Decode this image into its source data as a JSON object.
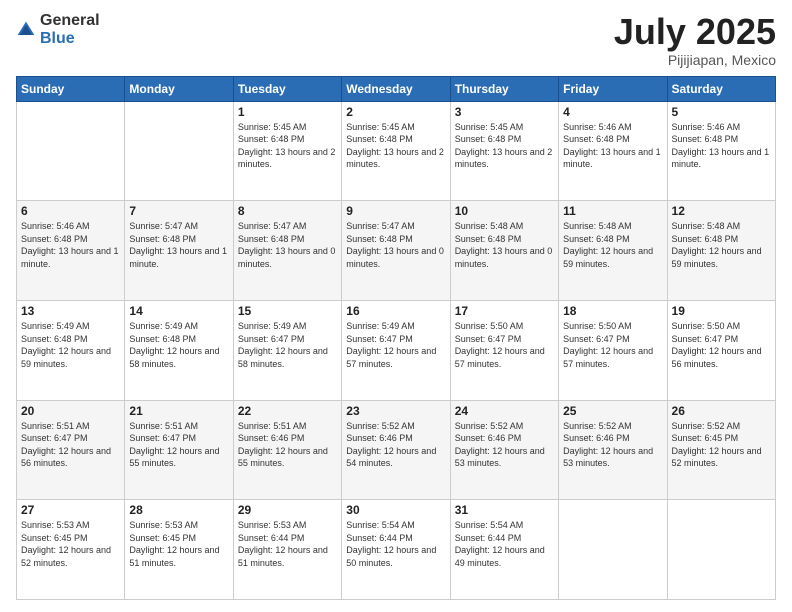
{
  "logo": {
    "general": "General",
    "blue": "Blue"
  },
  "header": {
    "month": "July 2025",
    "location": "Pijijiapan, Mexico"
  },
  "weekdays": [
    "Sunday",
    "Monday",
    "Tuesday",
    "Wednesday",
    "Thursday",
    "Friday",
    "Saturday"
  ],
  "weeks": [
    [
      {
        "day": "",
        "info": ""
      },
      {
        "day": "",
        "info": ""
      },
      {
        "day": "1",
        "info": "Sunrise: 5:45 AM\nSunset: 6:48 PM\nDaylight: 13 hours and 2 minutes."
      },
      {
        "day": "2",
        "info": "Sunrise: 5:45 AM\nSunset: 6:48 PM\nDaylight: 13 hours and 2 minutes."
      },
      {
        "day": "3",
        "info": "Sunrise: 5:45 AM\nSunset: 6:48 PM\nDaylight: 13 hours and 2 minutes."
      },
      {
        "day": "4",
        "info": "Sunrise: 5:46 AM\nSunset: 6:48 PM\nDaylight: 13 hours and 1 minute."
      },
      {
        "day": "5",
        "info": "Sunrise: 5:46 AM\nSunset: 6:48 PM\nDaylight: 13 hours and 1 minute."
      }
    ],
    [
      {
        "day": "6",
        "info": "Sunrise: 5:46 AM\nSunset: 6:48 PM\nDaylight: 13 hours and 1 minute."
      },
      {
        "day": "7",
        "info": "Sunrise: 5:47 AM\nSunset: 6:48 PM\nDaylight: 13 hours and 1 minute."
      },
      {
        "day": "8",
        "info": "Sunrise: 5:47 AM\nSunset: 6:48 PM\nDaylight: 13 hours and 0 minutes."
      },
      {
        "day": "9",
        "info": "Sunrise: 5:47 AM\nSunset: 6:48 PM\nDaylight: 13 hours and 0 minutes."
      },
      {
        "day": "10",
        "info": "Sunrise: 5:48 AM\nSunset: 6:48 PM\nDaylight: 13 hours and 0 minutes."
      },
      {
        "day": "11",
        "info": "Sunrise: 5:48 AM\nSunset: 6:48 PM\nDaylight: 12 hours and 59 minutes."
      },
      {
        "day": "12",
        "info": "Sunrise: 5:48 AM\nSunset: 6:48 PM\nDaylight: 12 hours and 59 minutes."
      }
    ],
    [
      {
        "day": "13",
        "info": "Sunrise: 5:49 AM\nSunset: 6:48 PM\nDaylight: 12 hours and 59 minutes."
      },
      {
        "day": "14",
        "info": "Sunrise: 5:49 AM\nSunset: 6:48 PM\nDaylight: 12 hours and 58 minutes."
      },
      {
        "day": "15",
        "info": "Sunrise: 5:49 AM\nSunset: 6:47 PM\nDaylight: 12 hours and 58 minutes."
      },
      {
        "day": "16",
        "info": "Sunrise: 5:49 AM\nSunset: 6:47 PM\nDaylight: 12 hours and 57 minutes."
      },
      {
        "day": "17",
        "info": "Sunrise: 5:50 AM\nSunset: 6:47 PM\nDaylight: 12 hours and 57 minutes."
      },
      {
        "day": "18",
        "info": "Sunrise: 5:50 AM\nSunset: 6:47 PM\nDaylight: 12 hours and 57 minutes."
      },
      {
        "day": "19",
        "info": "Sunrise: 5:50 AM\nSunset: 6:47 PM\nDaylight: 12 hours and 56 minutes."
      }
    ],
    [
      {
        "day": "20",
        "info": "Sunrise: 5:51 AM\nSunset: 6:47 PM\nDaylight: 12 hours and 56 minutes."
      },
      {
        "day": "21",
        "info": "Sunrise: 5:51 AM\nSunset: 6:47 PM\nDaylight: 12 hours and 55 minutes."
      },
      {
        "day": "22",
        "info": "Sunrise: 5:51 AM\nSunset: 6:46 PM\nDaylight: 12 hours and 55 minutes."
      },
      {
        "day": "23",
        "info": "Sunrise: 5:52 AM\nSunset: 6:46 PM\nDaylight: 12 hours and 54 minutes."
      },
      {
        "day": "24",
        "info": "Sunrise: 5:52 AM\nSunset: 6:46 PM\nDaylight: 12 hours and 53 minutes."
      },
      {
        "day": "25",
        "info": "Sunrise: 5:52 AM\nSunset: 6:46 PM\nDaylight: 12 hours and 53 minutes."
      },
      {
        "day": "26",
        "info": "Sunrise: 5:52 AM\nSunset: 6:45 PM\nDaylight: 12 hours and 52 minutes."
      }
    ],
    [
      {
        "day": "27",
        "info": "Sunrise: 5:53 AM\nSunset: 6:45 PM\nDaylight: 12 hours and 52 minutes."
      },
      {
        "day": "28",
        "info": "Sunrise: 5:53 AM\nSunset: 6:45 PM\nDaylight: 12 hours and 51 minutes."
      },
      {
        "day": "29",
        "info": "Sunrise: 5:53 AM\nSunset: 6:44 PM\nDaylight: 12 hours and 51 minutes."
      },
      {
        "day": "30",
        "info": "Sunrise: 5:54 AM\nSunset: 6:44 PM\nDaylight: 12 hours and 50 minutes."
      },
      {
        "day": "31",
        "info": "Sunrise: 5:54 AM\nSunset: 6:44 PM\nDaylight: 12 hours and 49 minutes."
      },
      {
        "day": "",
        "info": ""
      },
      {
        "day": "",
        "info": ""
      }
    ]
  ]
}
